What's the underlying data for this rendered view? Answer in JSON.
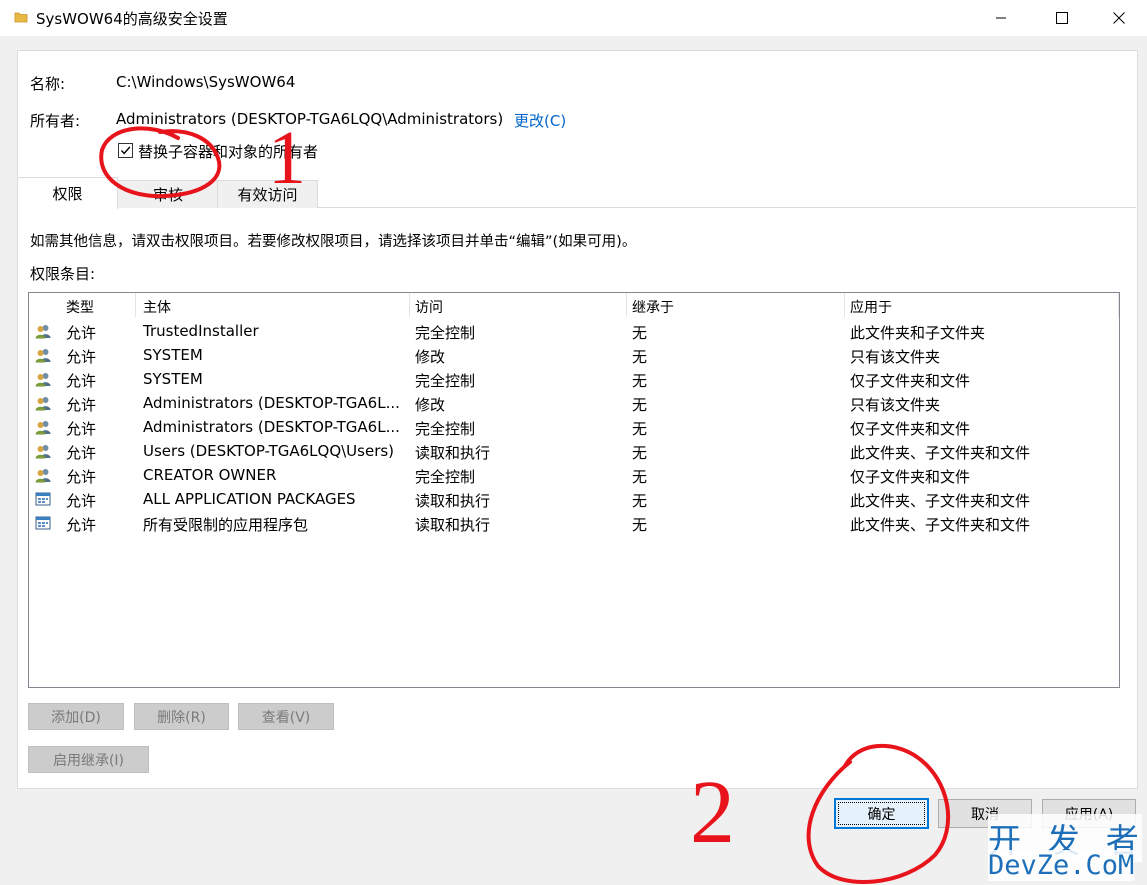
{
  "window": {
    "title": "SysWOW64的高级安全设置"
  },
  "details": {
    "name_label": "名称:",
    "name_value": "C:\\Windows\\SysWOW64",
    "owner_label": "所有者:",
    "owner_value": "Administrators (DESKTOP-TGA6LQQ\\Administrators)",
    "change_link": "更改(C)",
    "replace_owner_checkbox": "替换子容器和对象的所有者",
    "replace_owner_checked": true
  },
  "tabs": [
    {
      "label": "权限",
      "active": true
    },
    {
      "label": "审核",
      "active": false
    },
    {
      "label": "有效访问",
      "active": false
    }
  ],
  "instructions": "如需其他信息，请双击权限项目。若要修改权限项目，请选择该项目并单击“编辑”(如果可用)。",
  "entries_label": "权限条目:",
  "table": {
    "headers": [
      "类型",
      "主体",
      "访问",
      "继承于",
      "应用于"
    ],
    "rows": [
      {
        "icon": "user-group-icon",
        "type": "允许",
        "principal": "TrustedInstaller",
        "access": "完全控制",
        "inherited": "无",
        "applies": "此文件夹和子文件夹"
      },
      {
        "icon": "user-group-icon",
        "type": "允许",
        "principal": "SYSTEM",
        "access": "修改",
        "inherited": "无",
        "applies": "只有该文件夹"
      },
      {
        "icon": "user-group-icon",
        "type": "允许",
        "principal": "SYSTEM",
        "access": "完全控制",
        "inherited": "无",
        "applies": "仅子文件夹和文件"
      },
      {
        "icon": "user-group-icon",
        "type": "允许",
        "principal": "Administrators (DESKTOP-TGA6L...",
        "access": "修改",
        "inherited": "无",
        "applies": "只有该文件夹"
      },
      {
        "icon": "user-group-icon",
        "type": "允许",
        "principal": "Administrators (DESKTOP-TGA6L...",
        "access": "完全控制",
        "inherited": "无",
        "applies": "仅子文件夹和文件"
      },
      {
        "icon": "user-group-icon",
        "type": "允许",
        "principal": "Users (DESKTOP-TGA6LQQ\\Users)",
        "access": "读取和执行",
        "inherited": "无",
        "applies": "此文件夹、子文件夹和文件"
      },
      {
        "icon": "user-group-icon",
        "type": "允许",
        "principal": "CREATOR OWNER",
        "access": "完全控制",
        "inherited": "无",
        "applies": "仅子文件夹和文件"
      },
      {
        "icon": "app-package-icon",
        "type": "允许",
        "principal": "ALL APPLICATION PACKAGES",
        "access": "读取和执行",
        "inherited": "无",
        "applies": "此文件夹、子文件夹和文件"
      },
      {
        "icon": "app-package-icon",
        "type": "允许",
        "principal": "所有受限制的应用程序包",
        "access": "读取和执行",
        "inherited": "无",
        "applies": "此文件夹、子文件夹和文件"
      }
    ]
  },
  "buttons": {
    "add": "添加(D)",
    "remove": "删除(R)",
    "view": "查看(V)",
    "enable_inheritance": "启用继承(I)",
    "ok": "确定",
    "cancel": "取消",
    "apply": "应用(A)"
  },
  "annotations": {
    "mark_1": "1",
    "mark_2": "2"
  },
  "watermark": {
    "line1": "开 发 者",
    "line2": "DevZe.CoM"
  },
  "colors": {
    "link": "#0066cc",
    "annotation_red": "#e8141b",
    "watermark_blue": "#1c6fb8",
    "focus_blue": "#0078d7"
  }
}
